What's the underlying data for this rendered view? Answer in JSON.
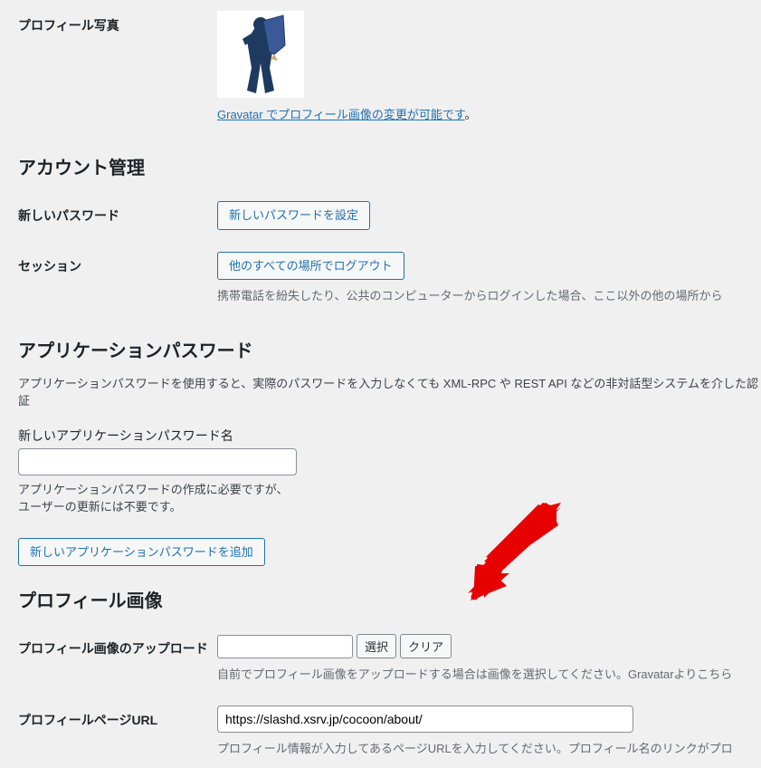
{
  "profile_photo": {
    "label": "プロフィール写真",
    "gravatar_link": "Gravatar でプロフィール画像の変更が可能です",
    "gravatar_suffix": "。"
  },
  "account_mgmt": {
    "heading": "アカウント管理",
    "new_password_label": "新しいパスワード",
    "new_password_button": "新しいパスワードを設定",
    "session_label": "セッション",
    "logout_button": "他のすべての場所でログアウト",
    "logout_desc": "携帯電話を紛失したり、公共のコンピューターからログインした場合、ここ以外の他の場所から"
  },
  "app_pw": {
    "heading": "アプリケーションパスワード",
    "desc": "アプリケーションパスワードを使用すると、実際のパスワードを入力しなくても XML-RPC や REST API などの非対話型システムを介した認証",
    "name_label": "新しいアプリケーションパスワード名",
    "name_desc1": "アプリケーションパスワードの作成に必要ですが、",
    "name_desc2": "ユーザーの更新には不要です。",
    "add_button": "新しいアプリケーションパスワードを追加"
  },
  "profile_img": {
    "heading": "プロフィール画像",
    "upload_label": "プロフィール画像のアップロード",
    "select_button": "選択",
    "clear_button": "クリア",
    "upload_desc": "自前でプロフィール画像をアップロードする場合は画像を選択してください。Gravatarよりこちら"
  },
  "profile_url": {
    "label": "プロフィールページURL",
    "value": "https://slashd.xsrv.jp/cocoon/about/",
    "desc": "プロフィール情報が入力してあるページURLを入力してください。プロフィール名のリンクがプロ"
  }
}
